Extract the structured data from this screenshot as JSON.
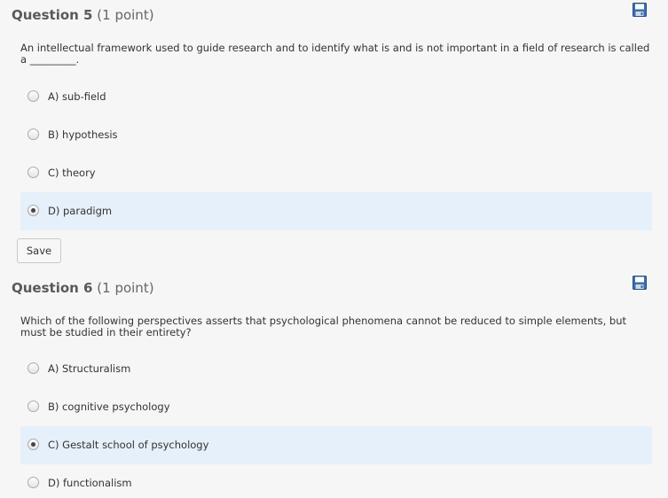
{
  "questions": [
    {
      "title": "Question 5",
      "points": "(1 point)",
      "text": "An intellectual framework used to guide research and to identify what is and is not important in a field of research is called a _________.",
      "options": [
        {
          "label": "A) sub-field",
          "selected": false
        },
        {
          "label": "B) hypothesis",
          "selected": false
        },
        {
          "label": "C) theory",
          "selected": false
        },
        {
          "label": "D) paradigm",
          "selected": true
        }
      ],
      "save_label": "Save"
    },
    {
      "title": "Question 6",
      "points": "(1 point)",
      "text": "Which of the following perspectives asserts that psychological phenomena cannot be reduced to simple elements, but must be studied in their entirety?",
      "options": [
        {
          "label": "A) Structuralism",
          "selected": false
        },
        {
          "label": "B) cognitive psychology",
          "selected": false
        },
        {
          "label": "C) Gestalt school of psychology",
          "selected": true
        },
        {
          "label": "D) functionalism",
          "selected": false
        }
      ]
    }
  ],
  "icons": {
    "save_question": "floppy-disk-icon"
  },
  "colors": {
    "selected_row": "#e6f0fa",
    "icon_blue": "#3a6fb0"
  }
}
